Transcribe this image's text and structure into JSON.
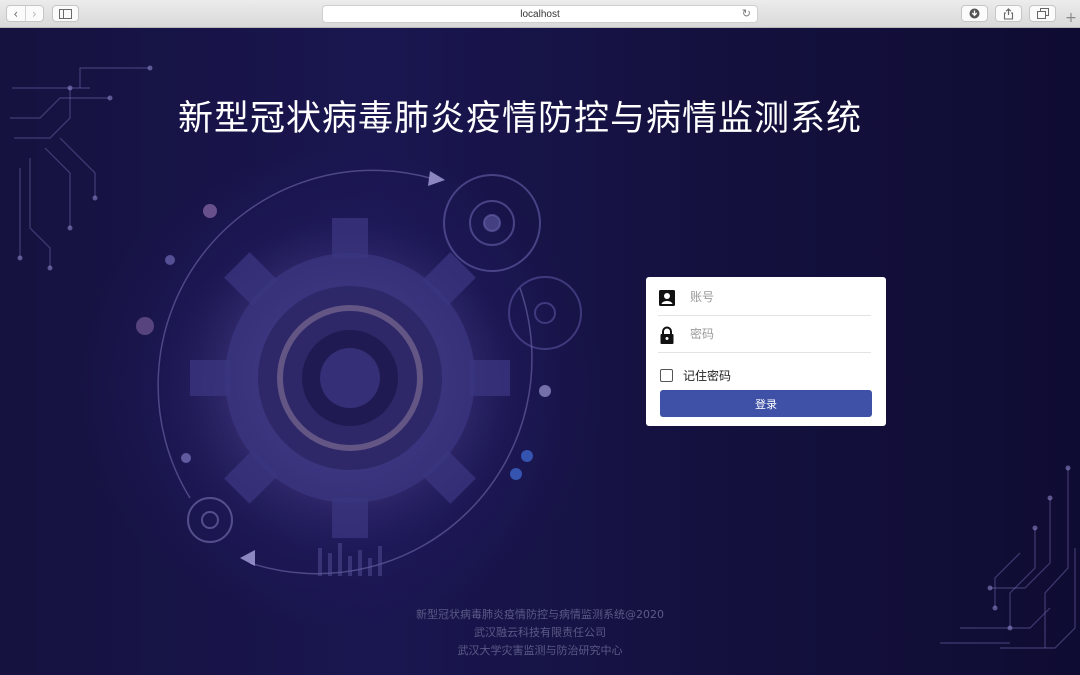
{
  "browser": {
    "url": "localhost",
    "back_glyph": "‹",
    "forward_glyph": "›",
    "new_tab_glyph": "+"
  },
  "page": {
    "title": "新型冠状病毒肺炎疫情防控与病情监测系统"
  },
  "login": {
    "username_placeholder": "账号",
    "password_placeholder": "密码",
    "username_icon": "user-card-icon",
    "password_icon": "lock-icon",
    "remember_label": "记住密码",
    "remember_checked": false,
    "submit_label": "登录",
    "button_color": "#3e51a6"
  },
  "footer": {
    "line1": "新型冠状病毒肺炎疫情防控与病情监测系统@2020",
    "line2": "武汉融云科技有限责任公司",
    "line3": "武汉大学灾害监测与防治研究中心"
  }
}
